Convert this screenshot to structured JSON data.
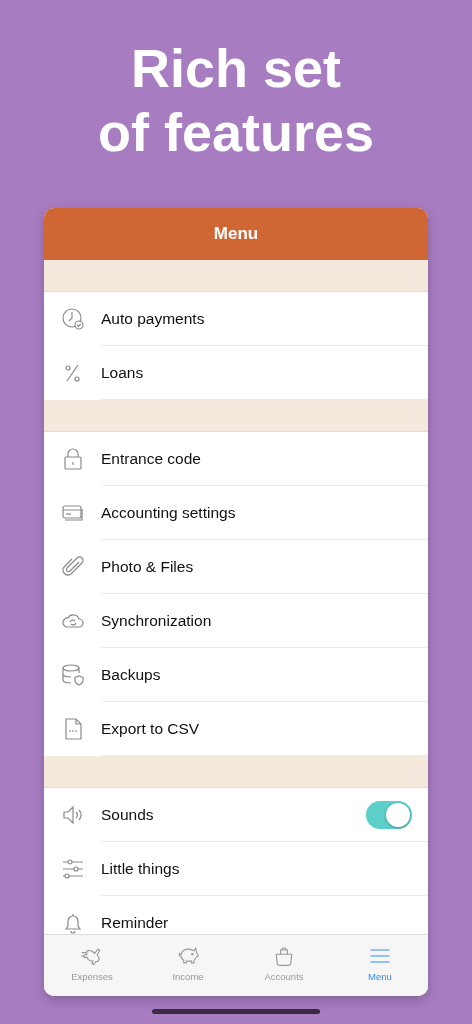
{
  "headline": [
    "Rich set",
    "of features"
  ],
  "screen": {
    "title": "Menu",
    "sections": [
      {
        "items": [
          {
            "label": "Auto payments",
            "kind": "link"
          },
          {
            "label": "Loans",
            "kind": "link"
          }
        ]
      },
      {
        "items": [
          {
            "label": "Entrance code",
            "kind": "link"
          },
          {
            "label": "Accounting settings",
            "kind": "link"
          },
          {
            "label": "Photo & Files",
            "kind": "link"
          },
          {
            "label": "Synchronization",
            "kind": "link"
          },
          {
            "label": "Backups",
            "kind": "link"
          },
          {
            "label": "Export to CSV",
            "kind": "link"
          }
        ]
      },
      {
        "items": [
          {
            "label": "Sounds",
            "kind": "toggle",
            "on": true
          },
          {
            "label": "Little things",
            "kind": "link"
          },
          {
            "label": "Reminder",
            "kind": "link"
          }
        ]
      }
    ],
    "tabs": [
      {
        "label": "Expenses",
        "selected": false
      },
      {
        "label": "Income",
        "selected": false
      },
      {
        "label": "Accounts",
        "selected": false
      },
      {
        "label": "Menu",
        "selected": true
      }
    ]
  }
}
